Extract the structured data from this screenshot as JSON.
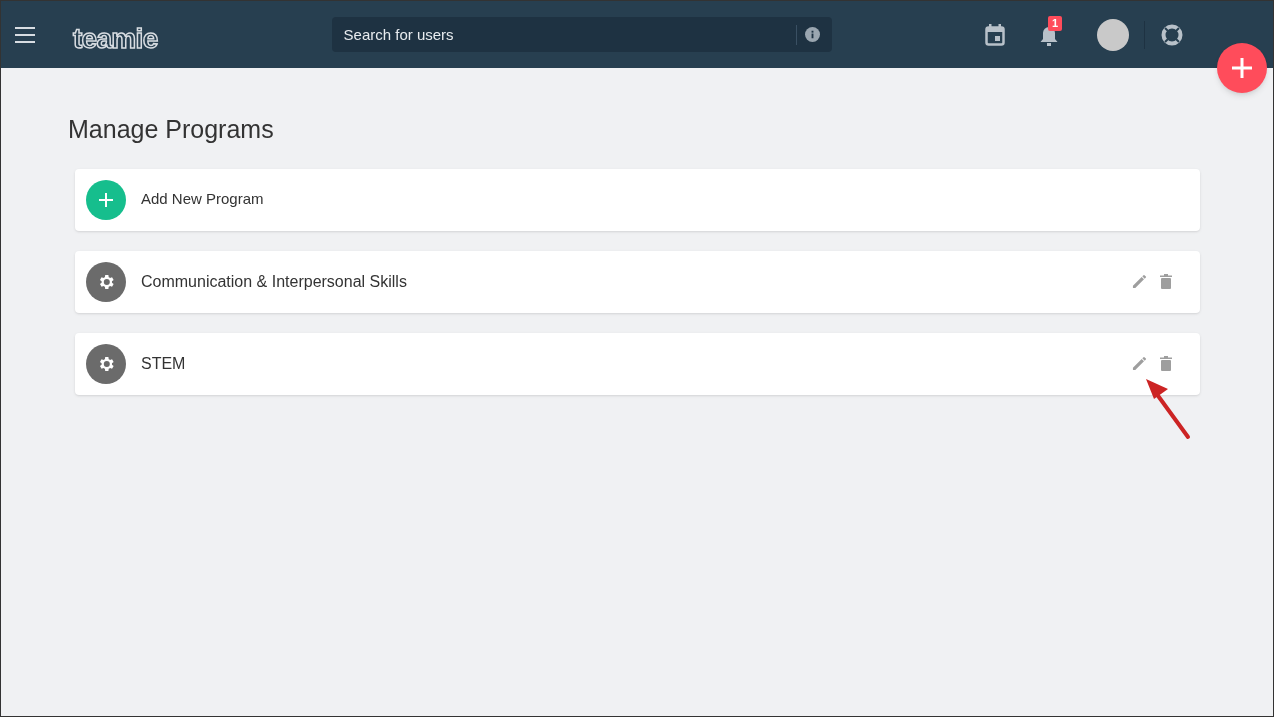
{
  "header": {
    "logo": "teamie",
    "search": {
      "placeholder": "Search for users"
    },
    "notification_count": "1"
  },
  "page": {
    "title": "Manage Programs"
  },
  "add_item": {
    "label": "Add New Program"
  },
  "programs": [
    {
      "name": "Communication & Interpersonal Skills",
      "annotated": false
    },
    {
      "name": "STEM",
      "annotated": true
    }
  ]
}
